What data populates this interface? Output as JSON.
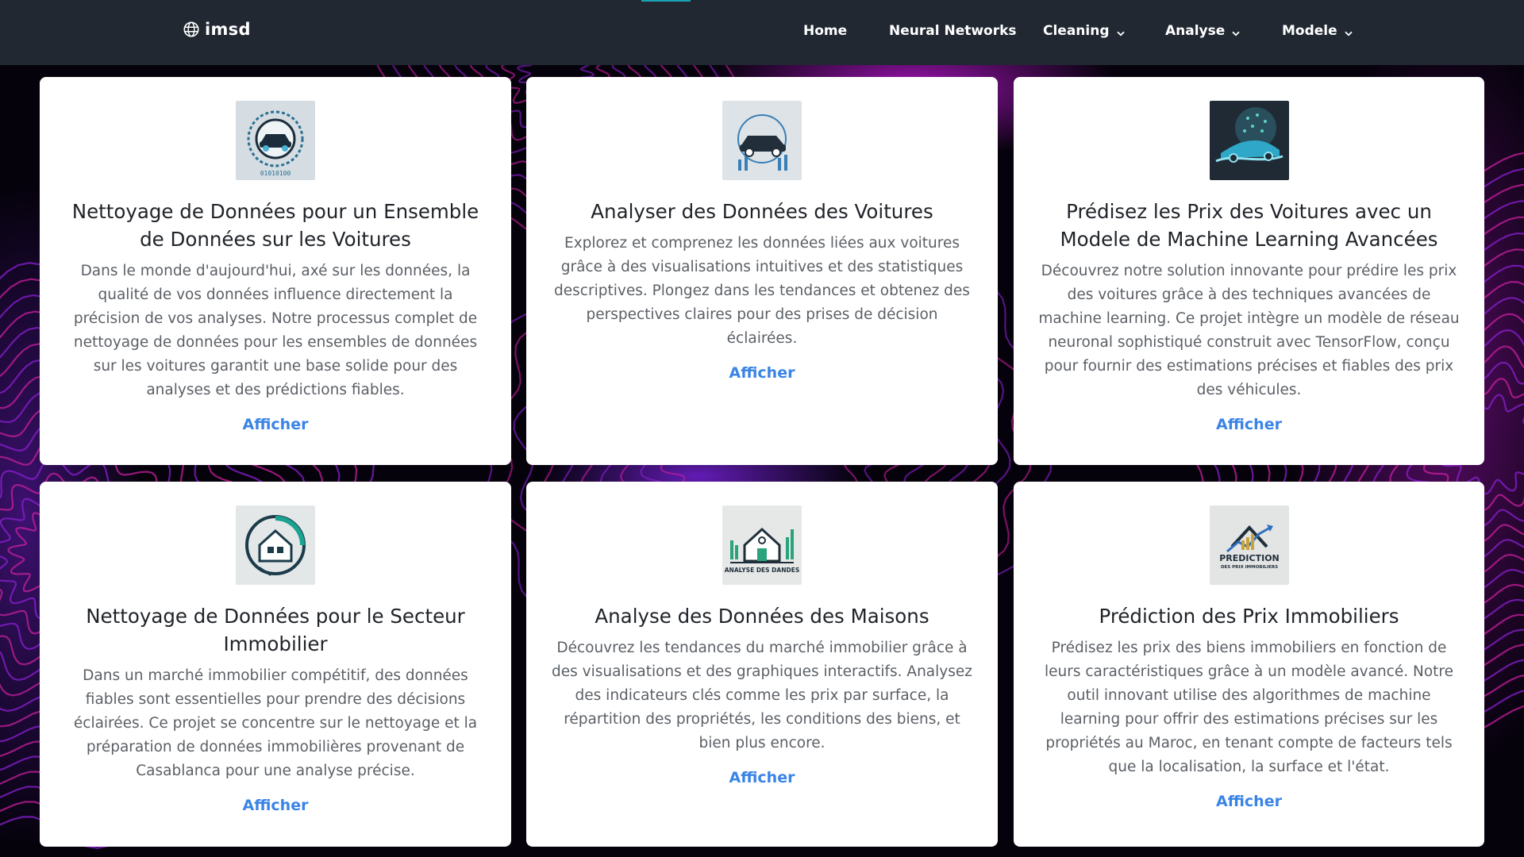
{
  "brand": {
    "name": "imsd",
    "icon": "globe-icon"
  },
  "nav": {
    "items": [
      {
        "label": "Home",
        "dropdown": false
      },
      {
        "label": "Neural Networks",
        "dropdown": false
      },
      {
        "label": "Cleaning",
        "dropdown": true
      },
      {
        "label": "Analyse",
        "dropdown": true
      },
      {
        "label": "Modele",
        "dropdown": true
      }
    ]
  },
  "colors": {
    "navbar": "#212832",
    "link": "#3a84e6",
    "background_swirl_1": "#8a1fd0",
    "background_swirl_2": "#c71f9e"
  },
  "cards": [
    {
      "title": "Nettoyage de Données pour un Ensemble de Données sur les Voitures",
      "description": "Dans le monde d'aujourd'hui, axé sur les données, la qualité de vos données influence directement la précision de vos analyses. Notre processus complet de nettoyage de données pour les ensembles de données sur les voitures garantit une base solide pour des analyses et des prédictions fiables.",
      "link": "Afficher",
      "image": "car-cleaning-icon"
    },
    {
      "title": "Analyser des Données des Voitures",
      "description": "Explorez et comprenez les données liées aux voitures grâce à des visualisations intuitives et des statistiques descriptives. Plongez dans les tendances et obtenez des perspectives claires pour des prises de décision éclairées.",
      "link": "Afficher",
      "image": "car-analysis-icon"
    },
    {
      "title": "Prédisez les Prix des Voitures avec un Modele de Machine Learning Avancées",
      "description": "Découvrez notre solution innovante pour prédire les prix des voitures grâce à des techniques avancées de machine learning. Ce projet intègre un modèle de réseau neuronal sophistiqué construit avec TensorFlow, conçu pour fournir des estimations précises et fiables des prix des véhicules.",
      "link": "Afficher",
      "image": "car-prediction-icon"
    },
    {
      "title": "Nettoyage de Données pour le Secteur Immobilier",
      "description": "Dans un marché immobilier compétitif, des données fiables sont essentielles pour prendre des décisions éclairées. Ce projet se concentre sur le nettoyage et la préparation de données immobilières provenant de Casablanca pour une analyse précise.",
      "link": "Afficher",
      "image": "house-cleaning-icon"
    },
    {
      "title": "Analyse des Données des Maisons",
      "description": "Découvrez les tendances du marché immobilier grâce à des visualisations et des graphiques interactifs. Analysez des indicateurs clés comme les prix par surface, la répartition des propriétés, les conditions des biens, et bien plus encore.",
      "link": "Afficher",
      "image": "house-analysis-icon",
      "image_text": "ANALYSE DES DANDES"
    },
    {
      "title": "Prédiction des Prix Immobiliers",
      "description": "Prédisez les prix des biens immobiliers en fonction de leurs caractéristiques grâce à un modèle avancé. Notre outil innovant utilise des algorithmes de machine learning pour offrir des estimations précises sur les propriétés au Maroc, en tenant compte de facteurs tels que la localisation, la surface et l'état.",
      "link": "Afficher",
      "image": "house-prediction-icon",
      "image_text": "PREDICTION",
      "image_subtext": "DES PRIX IMMOBILIERS"
    }
  ]
}
